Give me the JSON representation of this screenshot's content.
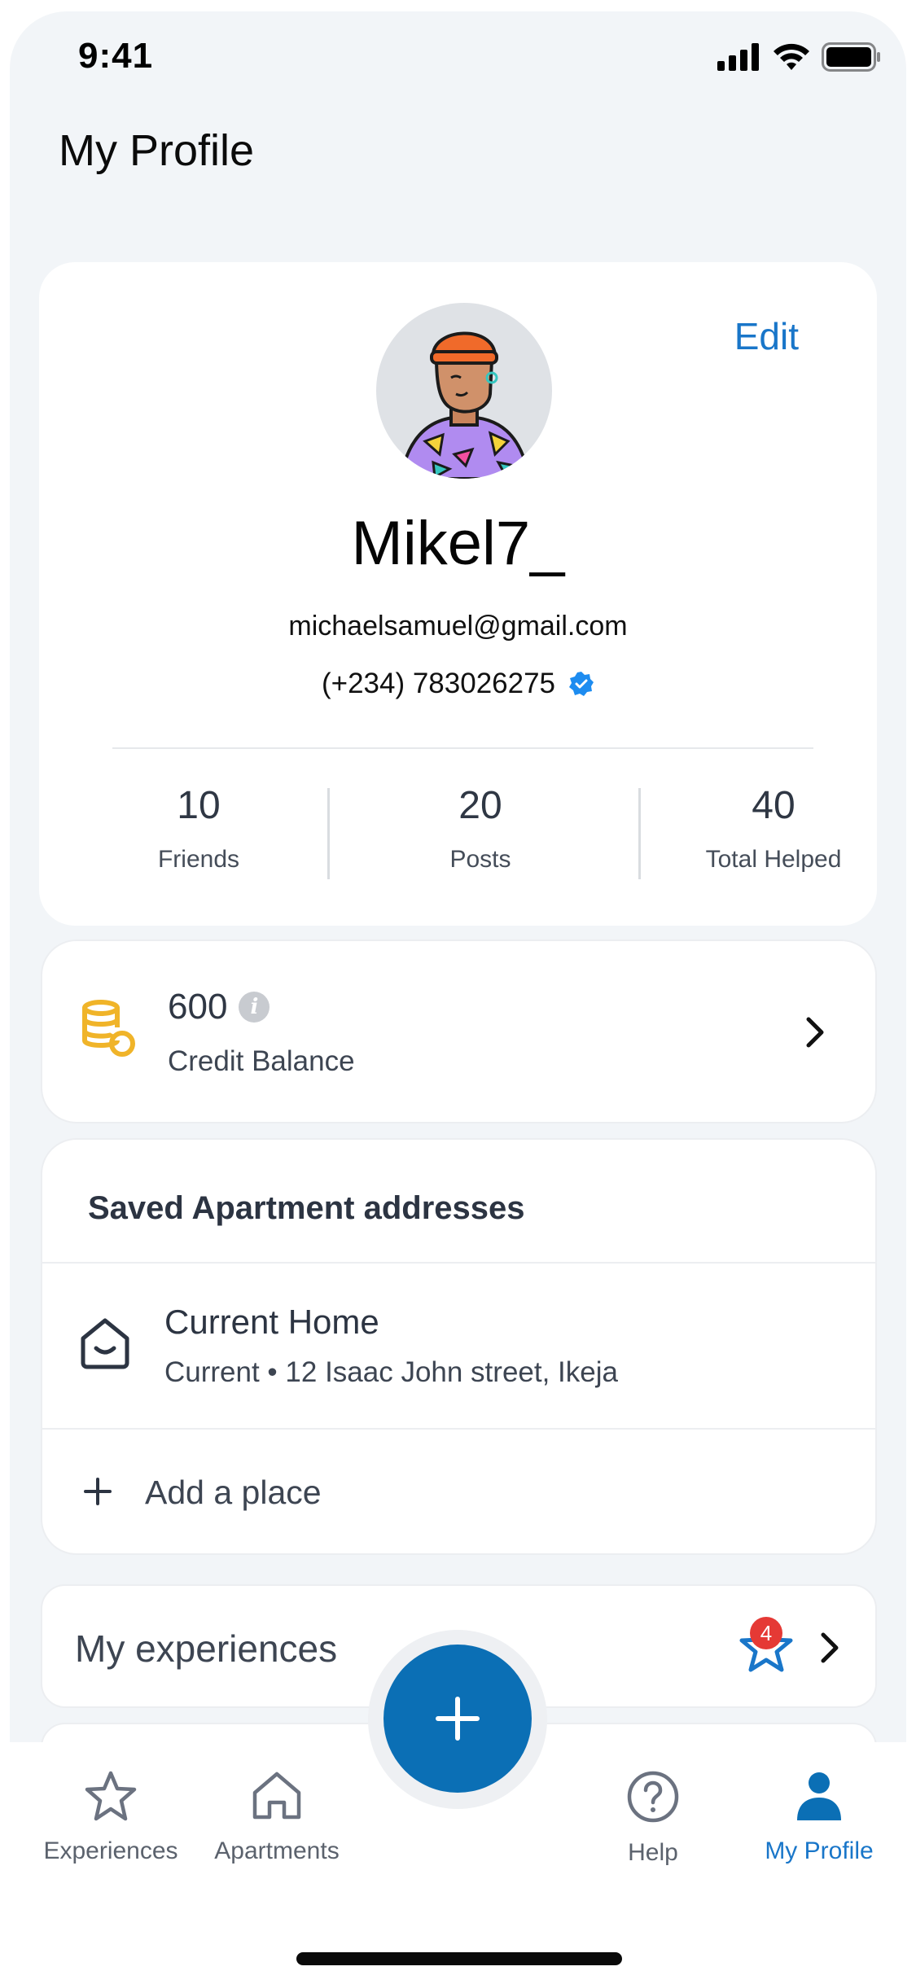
{
  "status_bar": {
    "time": "9:41"
  },
  "header": {
    "title": "My Profile"
  },
  "profile": {
    "edit_label": "Edit",
    "username": "Mikel7_",
    "email": "michaelsamuel@gmail.com",
    "phone": "(+234) 783026275",
    "stats": [
      {
        "value": "10",
        "label": "Friends"
      },
      {
        "value": "20",
        "label": "Posts"
      },
      {
        "value": "40",
        "label": "Total Helped"
      }
    ]
  },
  "credit": {
    "amount": "600",
    "label": "Credit Balance",
    "info_icon": "i"
  },
  "saved_addresses": {
    "title": "Saved Apartment addresses",
    "items": [
      {
        "title": "Current Home",
        "subtitle": "Current • 12 Isaac John street, Ikeja"
      }
    ],
    "add_label": "Add a place"
  },
  "experiences": {
    "title": "My experiences",
    "badge_count": "4"
  },
  "tabbar": {
    "tabs": [
      {
        "label": "Experiences",
        "icon": "star-icon"
      },
      {
        "label": "Apartments",
        "icon": "house-icon"
      },
      {
        "label": "Help",
        "icon": "help-icon"
      },
      {
        "label": "My Profile",
        "icon": "person-icon",
        "active": true
      }
    ],
    "fab_icon": "plus-icon"
  },
  "colors": {
    "accent": "#1976c9",
    "fab": "#0b6fb5",
    "coin": "#f0b429",
    "badge": "#e53935",
    "verified": "#1d8cf0"
  }
}
